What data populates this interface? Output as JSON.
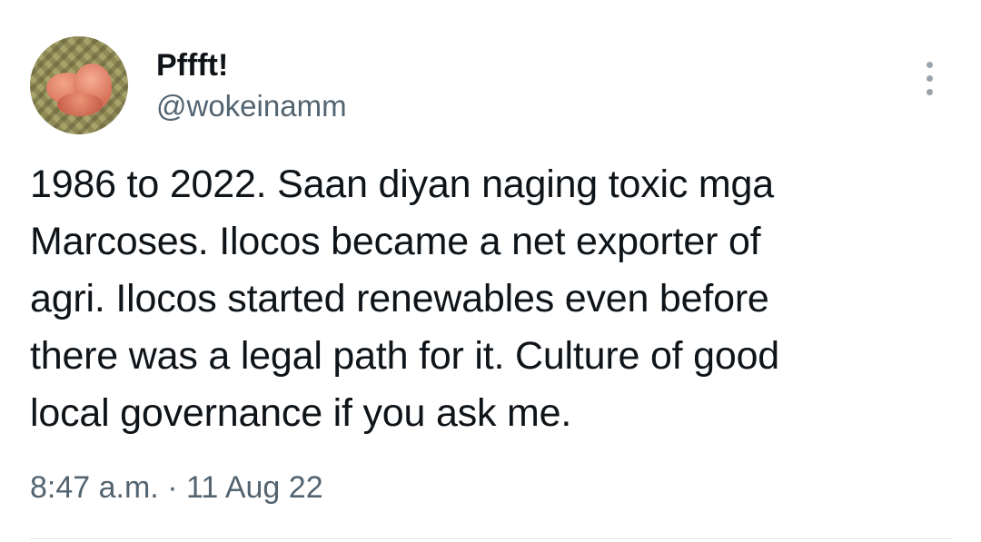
{
  "tweet": {
    "author": {
      "display_name": "Pffft!",
      "handle": "@wokeinamm",
      "avatar_icon": "profile-photo"
    },
    "more_icon": "more-vertical-icon",
    "text_lines": [
      "1986 to 2022. Saan diyan naging toxic mga",
      "Marcoses. Ilocos became a net exporter of",
      "agri. Ilocos started renewables even before",
      "there was a legal path for it. Culture of good",
      "local governance if you ask me."
    ],
    "time": "8:47 a.m.",
    "separator": "·",
    "date": "11 Aug 22"
  },
  "colors": {
    "text_primary": "#0f1419",
    "text_secondary": "#536471",
    "divider": "#e4e8eb"
  }
}
